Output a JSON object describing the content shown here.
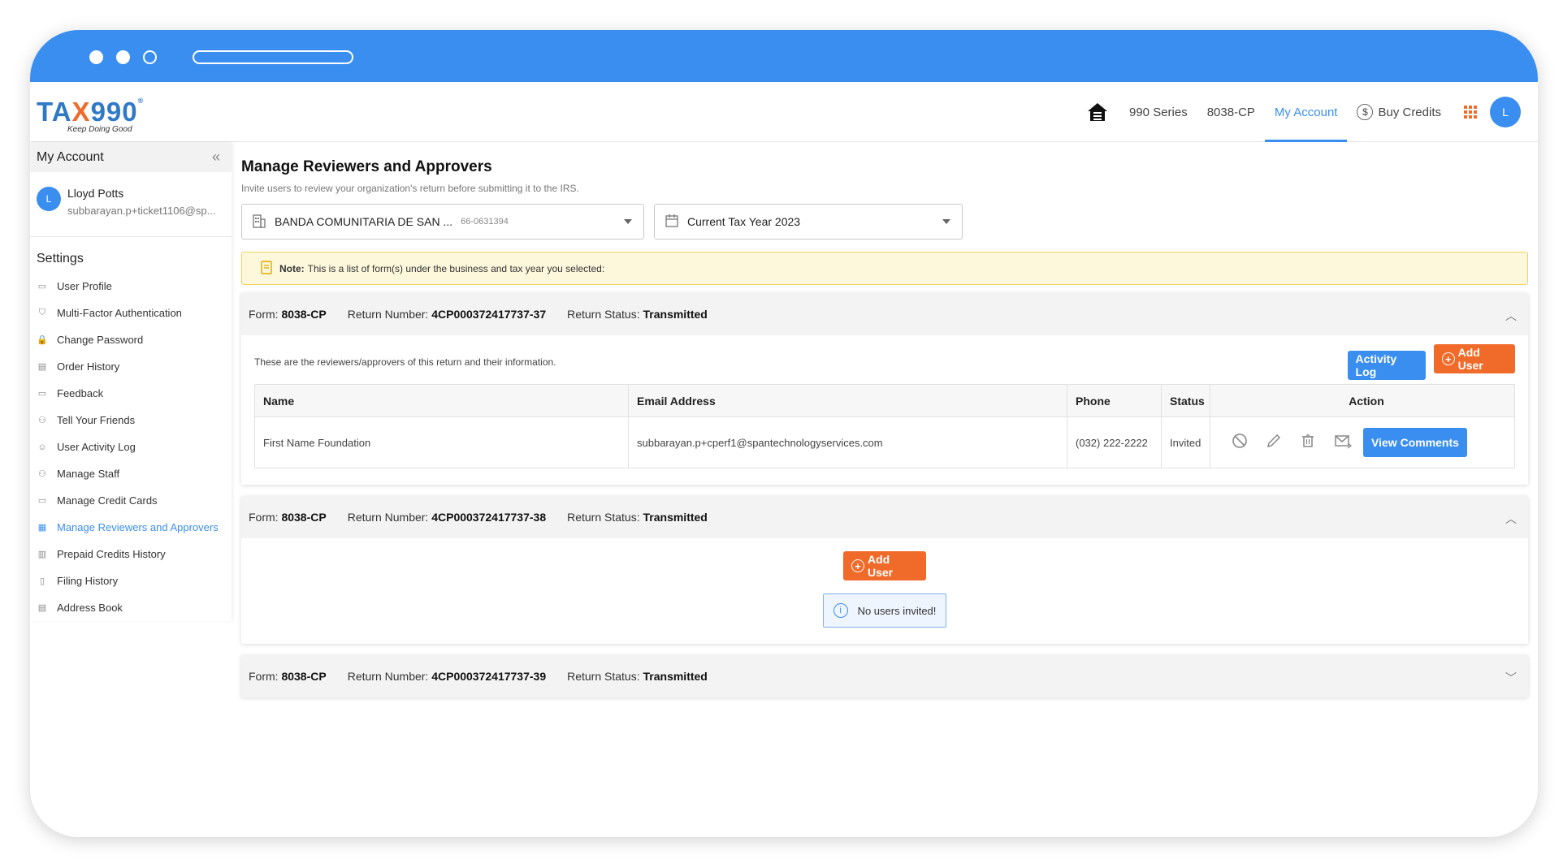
{
  "brand": {
    "logo_text_pre": "TA",
    "logo_text_x": "X",
    "logo_text_post": "990",
    "registered": "®",
    "tagline": "Keep Doing Good"
  },
  "nav": {
    "home_icon": "home-icon",
    "items": [
      "990 Series",
      "8038-CP",
      "My Account"
    ],
    "buy_credits": "Buy Credits",
    "active": "My Account"
  },
  "user": {
    "initial": "L",
    "name": "Lloyd Potts",
    "email": "subbarayan.p+ticket1106@sp..."
  },
  "sidebar": {
    "header": "My Account",
    "settings_label": "Settings",
    "items": [
      {
        "label": "User Profile",
        "icon": "id-card-icon"
      },
      {
        "label": "Multi-Factor Authentication",
        "icon": "shield-icon"
      },
      {
        "label": "Change Password",
        "icon": "lock-icon"
      },
      {
        "label": "Order History",
        "icon": "receipt-icon"
      },
      {
        "label": "Feedback",
        "icon": "comment-icon"
      },
      {
        "label": "Tell Your Friends",
        "icon": "people-icon"
      },
      {
        "label": "User Activity Log",
        "icon": "user-log-icon"
      },
      {
        "label": "Manage Staff",
        "icon": "staff-icon"
      },
      {
        "label": "Manage Credit Cards",
        "icon": "credit-card-icon"
      },
      {
        "label": "Manage Reviewers and Approvers",
        "icon": "reviewers-icon"
      },
      {
        "label": "Prepaid Credits History",
        "icon": "chart-icon"
      },
      {
        "label": "Filing History",
        "icon": "file-icon"
      },
      {
        "label": "Address Book",
        "icon": "address-book-icon"
      }
    ],
    "active_index": 9
  },
  "page": {
    "title": "Manage Reviewers and Approvers",
    "subtitle": "Invite users to review your organization's return before submitting it to the IRS.",
    "org_select": {
      "value": "BANDA COMUNITARIA DE SAN ...",
      "ein": "66-0631394"
    },
    "year_select": {
      "value": "Current Tax Year 2023"
    },
    "note_label": "Note:",
    "note_text": "This is a list of form(s) under the business and tax year you selected:"
  },
  "forms": [
    {
      "form_label": "Form:",
      "form": "8038-CP",
      "return_label": "Return Number:",
      "return_number": "4CP000372417737-37",
      "status_label": "Return Status:",
      "status": "Transmitted",
      "expanded": true,
      "intro": "These are the reviewers/approvers of this return and their information.",
      "activity_log": "Activity Log",
      "add_user": "Add User",
      "columns": [
        "Name",
        "Email Address",
        "Phone",
        "Status",
        "Action"
      ],
      "rows": [
        {
          "name": "First Name Foundation",
          "email": "subbarayan.p+cperf1@spantechnologyservices.com",
          "phone": "(032) 222-2222",
          "status": "Invited",
          "view_comments": "View Comments"
        }
      ]
    },
    {
      "form_label": "Form:",
      "form": "8038-CP",
      "return_label": "Return Number:",
      "return_number": "4CP000372417737-38",
      "status_label": "Return Status:",
      "status": "Transmitted",
      "expanded": true,
      "add_user": "Add User",
      "empty_message": "No users invited!"
    },
    {
      "form_label": "Form:",
      "form": "8038-CP",
      "return_label": "Return Number:",
      "return_number": "4CP000372417737-39",
      "status_label": "Return Status:",
      "status": "Transmitted",
      "expanded": false
    }
  ],
  "colors": {
    "primary": "#3a8ef0",
    "accent": "#f06b2a",
    "note_bg": "#fdf8dc"
  }
}
